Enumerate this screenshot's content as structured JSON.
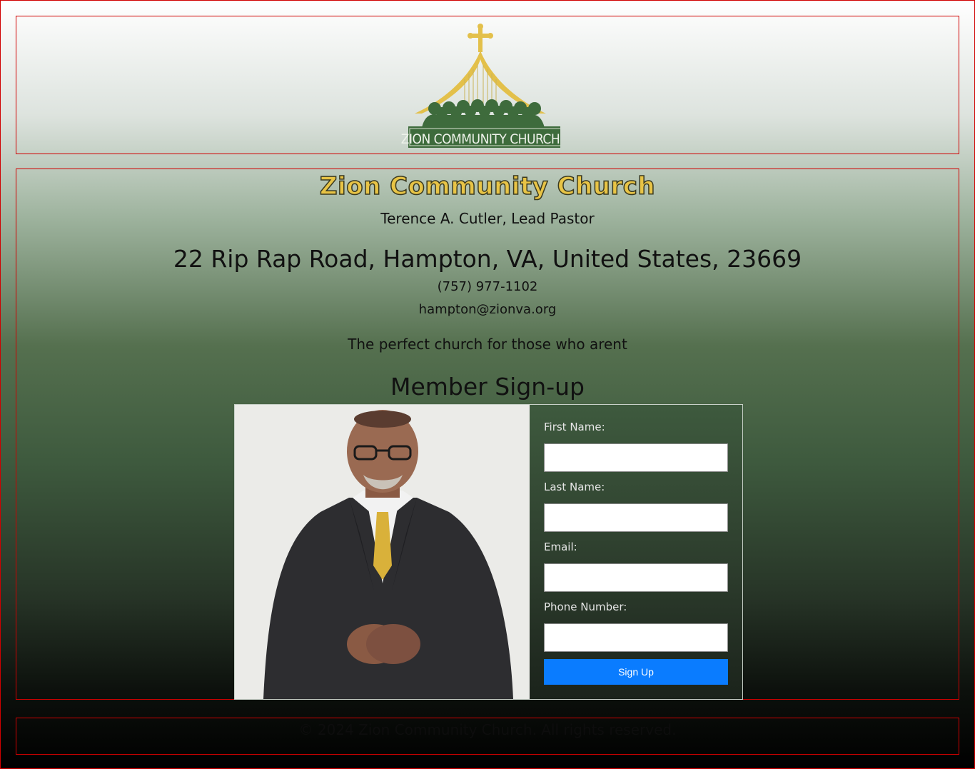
{
  "header": {
    "logo_text": "ZION COMMUNITY CHURCH"
  },
  "main": {
    "church_name": "Zion Community Church",
    "pastor": "Terence A. Cutler, Lead Pastor",
    "address": "22 Rip Rap Road, Hampton, VA, United States, 23669",
    "phone": "(757) 977-1102",
    "email": "hampton@zionva.org",
    "tagline": "The perfect church for those who arent",
    "signup_title": "Member Sign-up"
  },
  "form": {
    "first_name_label": "First Name:",
    "first_name_value": "",
    "last_name_label": "Last Name:",
    "last_name_value": "",
    "email_label": "Email:",
    "email_value": "",
    "phone_label": "Phone Number:",
    "phone_value": "",
    "submit_label": "Sign Up"
  },
  "footer": {
    "copyright": "© 2024 Zion Community Church. All rights reserved."
  },
  "colors": {
    "border": "#d00000",
    "title_gold": "#e8c446",
    "logo_green": "#3e6b3c",
    "button_blue": "#0a7cff"
  }
}
